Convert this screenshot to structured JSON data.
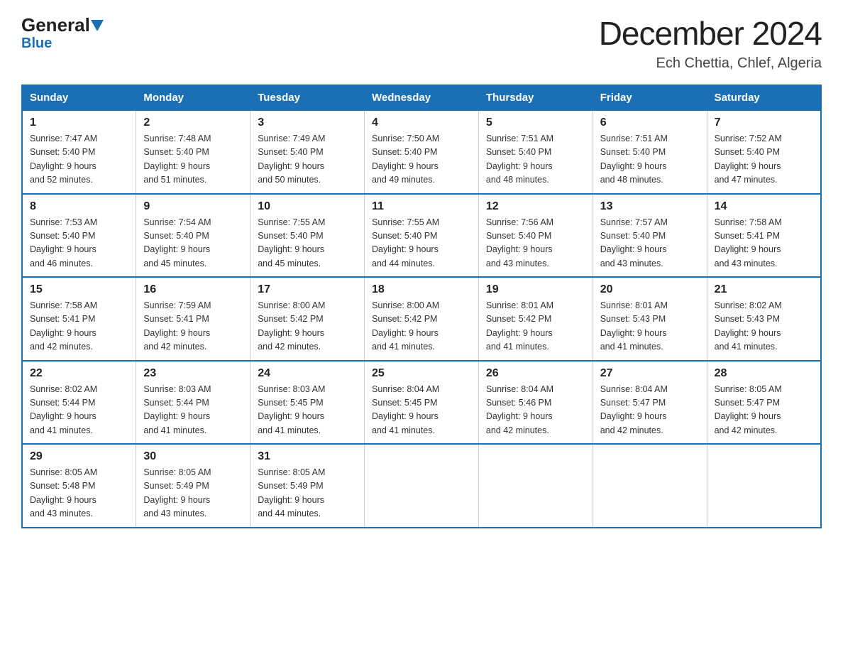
{
  "header": {
    "logo_general": "General",
    "logo_blue": "Blue",
    "title": "December 2024",
    "subtitle": "Ech Chettia, Chlef, Algeria"
  },
  "weekdays": [
    "Sunday",
    "Monday",
    "Tuesday",
    "Wednesday",
    "Thursday",
    "Friday",
    "Saturday"
  ],
  "weeks": [
    [
      {
        "day": "1",
        "sunrise": "7:47 AM",
        "sunset": "5:40 PM",
        "daylight": "9 hours and 52 minutes."
      },
      {
        "day": "2",
        "sunrise": "7:48 AM",
        "sunset": "5:40 PM",
        "daylight": "9 hours and 51 minutes."
      },
      {
        "day": "3",
        "sunrise": "7:49 AM",
        "sunset": "5:40 PM",
        "daylight": "9 hours and 50 minutes."
      },
      {
        "day": "4",
        "sunrise": "7:50 AM",
        "sunset": "5:40 PM",
        "daylight": "9 hours and 49 minutes."
      },
      {
        "day": "5",
        "sunrise": "7:51 AM",
        "sunset": "5:40 PM",
        "daylight": "9 hours and 48 minutes."
      },
      {
        "day": "6",
        "sunrise": "7:51 AM",
        "sunset": "5:40 PM",
        "daylight": "9 hours and 48 minutes."
      },
      {
        "day": "7",
        "sunrise": "7:52 AM",
        "sunset": "5:40 PM",
        "daylight": "9 hours and 47 minutes."
      }
    ],
    [
      {
        "day": "8",
        "sunrise": "7:53 AM",
        "sunset": "5:40 PM",
        "daylight": "9 hours and 46 minutes."
      },
      {
        "day": "9",
        "sunrise": "7:54 AM",
        "sunset": "5:40 PM",
        "daylight": "9 hours and 45 minutes."
      },
      {
        "day": "10",
        "sunrise": "7:55 AM",
        "sunset": "5:40 PM",
        "daylight": "9 hours and 45 minutes."
      },
      {
        "day": "11",
        "sunrise": "7:55 AM",
        "sunset": "5:40 PM",
        "daylight": "9 hours and 44 minutes."
      },
      {
        "day": "12",
        "sunrise": "7:56 AM",
        "sunset": "5:40 PM",
        "daylight": "9 hours and 43 minutes."
      },
      {
        "day": "13",
        "sunrise": "7:57 AM",
        "sunset": "5:40 PM",
        "daylight": "9 hours and 43 minutes."
      },
      {
        "day": "14",
        "sunrise": "7:58 AM",
        "sunset": "5:41 PM",
        "daylight": "9 hours and 43 minutes."
      }
    ],
    [
      {
        "day": "15",
        "sunrise": "7:58 AM",
        "sunset": "5:41 PM",
        "daylight": "9 hours and 42 minutes."
      },
      {
        "day": "16",
        "sunrise": "7:59 AM",
        "sunset": "5:41 PM",
        "daylight": "9 hours and 42 minutes."
      },
      {
        "day": "17",
        "sunrise": "8:00 AM",
        "sunset": "5:42 PM",
        "daylight": "9 hours and 42 minutes."
      },
      {
        "day": "18",
        "sunrise": "8:00 AM",
        "sunset": "5:42 PM",
        "daylight": "9 hours and 41 minutes."
      },
      {
        "day": "19",
        "sunrise": "8:01 AM",
        "sunset": "5:42 PM",
        "daylight": "9 hours and 41 minutes."
      },
      {
        "day": "20",
        "sunrise": "8:01 AM",
        "sunset": "5:43 PM",
        "daylight": "9 hours and 41 minutes."
      },
      {
        "day": "21",
        "sunrise": "8:02 AM",
        "sunset": "5:43 PM",
        "daylight": "9 hours and 41 minutes."
      }
    ],
    [
      {
        "day": "22",
        "sunrise": "8:02 AM",
        "sunset": "5:44 PM",
        "daylight": "9 hours and 41 minutes."
      },
      {
        "day": "23",
        "sunrise": "8:03 AM",
        "sunset": "5:44 PM",
        "daylight": "9 hours and 41 minutes."
      },
      {
        "day": "24",
        "sunrise": "8:03 AM",
        "sunset": "5:45 PM",
        "daylight": "9 hours and 41 minutes."
      },
      {
        "day": "25",
        "sunrise": "8:04 AM",
        "sunset": "5:45 PM",
        "daylight": "9 hours and 41 minutes."
      },
      {
        "day": "26",
        "sunrise": "8:04 AM",
        "sunset": "5:46 PM",
        "daylight": "9 hours and 42 minutes."
      },
      {
        "day": "27",
        "sunrise": "8:04 AM",
        "sunset": "5:47 PM",
        "daylight": "9 hours and 42 minutes."
      },
      {
        "day": "28",
        "sunrise": "8:05 AM",
        "sunset": "5:47 PM",
        "daylight": "9 hours and 42 minutes."
      }
    ],
    [
      {
        "day": "29",
        "sunrise": "8:05 AM",
        "sunset": "5:48 PM",
        "daylight": "9 hours and 43 minutes."
      },
      {
        "day": "30",
        "sunrise": "8:05 AM",
        "sunset": "5:49 PM",
        "daylight": "9 hours and 43 minutes."
      },
      {
        "day": "31",
        "sunrise": "8:05 AM",
        "sunset": "5:49 PM",
        "daylight": "9 hours and 44 minutes."
      },
      null,
      null,
      null,
      null
    ]
  ],
  "labels": {
    "sunrise": "Sunrise:",
    "sunset": "Sunset:",
    "daylight": "Daylight:"
  },
  "colors": {
    "header_bg": "#1a6fb5",
    "header_text": "#ffffff",
    "border": "#1a6fb5",
    "cell_border": "#cccccc"
  }
}
